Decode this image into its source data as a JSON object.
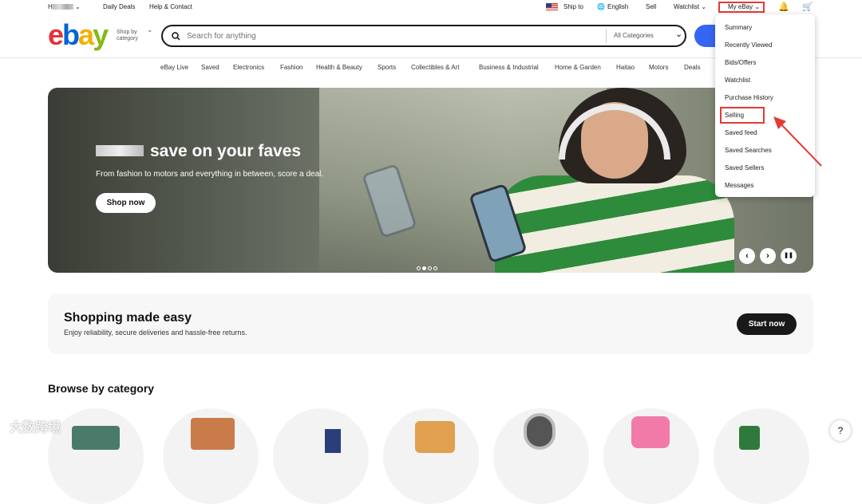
{
  "topbar": {
    "greeting": "H",
    "daily_deals": "Daily Deals",
    "help_contact": "Help & Contact",
    "ship_to": "Ship to",
    "language": "English",
    "sell": "Sell",
    "watchlist": "Watchlist",
    "my_ebay": "My eBay"
  },
  "header": {
    "logo": {
      "e": "e",
      "b": "b",
      "a": "a",
      "y": "y"
    },
    "shop_by_line1": "Shop by",
    "shop_by_line2": "category",
    "search_placeholder": "Search for anything",
    "category_select": "All Categories"
  },
  "nav": [
    "eBay Live",
    "Saved",
    "Electronics",
    "Fashion",
    "Health & Beauty",
    "Sports",
    "Collectibles & Art",
    "Business & Industrial",
    "Home & Garden",
    "Haitao",
    "Motors",
    "Deals"
  ],
  "hero": {
    "title": "save on your faves",
    "subtitle": "From fashion to motors and everything in between, score a deal.",
    "button": "Shop now",
    "slide_count": 4,
    "active_slide": 2,
    "prev": "‹",
    "next": "›",
    "pause": "❚❚"
  },
  "easy": {
    "title": "Shopping made easy",
    "subtitle": "Enjoy reliability, secure deliveries and hassle-free returns.",
    "button": "Start now"
  },
  "browse": {
    "title": "Browse by category"
  },
  "dropdown": {
    "items": [
      "Summary",
      "Recently Viewed",
      "Bids/Offers",
      "Watchlist",
      "Purchase History",
      "Selling",
      "Saved feed",
      "Saved Searches",
      "Saved Sellers",
      "Messages"
    ]
  },
  "help": "?",
  "watermark": "大数跨境",
  "colors": {
    "accent_blue": "#3665f3",
    "highlight_red": "#e53935"
  }
}
